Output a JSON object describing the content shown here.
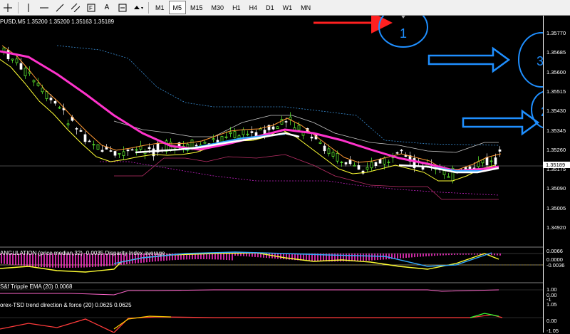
{
  "toolbar": {
    "tools": [
      "crosshair-icon",
      "vertical-line-icon",
      "horizontal-line-icon",
      "trendline-icon",
      "channel-icon",
      "fibonacci-icon",
      "text-icon",
      "label-icon",
      "shapes-icon"
    ],
    "text_tool": "A",
    "fib_label": "F",
    "timeframes": [
      "M1",
      "M5",
      "M15",
      "M30",
      "H1",
      "H4",
      "D1",
      "W1",
      "MN"
    ],
    "active_timeframe": "M5"
  },
  "symbol_info": "PUSD,M5  1.35200 1.35200 1.35163 1.35189",
  "price_axis": {
    "labels": [
      "1.35770",
      "1.35685",
      "1.35600",
      "1.35515",
      "1.35430",
      "1.35345",
      "1.35260",
      "1.35175",
      "1.35090",
      "1.35005",
      "1.34920"
    ],
    "current_price": "1.35189"
  },
  "annotations": [
    {
      "label": "1",
      "color": "#1f8fff"
    },
    {
      "label": "2",
      "color": "#1f8fff"
    },
    {
      "label": "3",
      "color": "#1f8fff"
    }
  ],
  "indicators": [
    {
      "label": "ANGULATION (price median,32) -0.0035  Disparity  Index average  ...",
      "scale": [
        "0.0066",
        "0.0000",
        "-0.0036"
      ]
    },
    {
      "label": "S&f Tripple EMA (20) 0.0068",
      "scale": [
        "1.00",
        "0.00",
        "-1"
      ]
    },
    {
      "label": "orex-TSD trend direction & force (20) 0.0625 0.0625",
      "scale": [
        "1.05",
        "0.00",
        "-1.05"
      ]
    }
  ],
  "colors": {
    "background": "#000000",
    "bull_candle": "#66ff33",
    "ema_magenta": "#ff33cc",
    "ema_white": "#ffffff",
    "ema_blue": "#33aaff",
    "ema_yellow": "#ffff33",
    "ema_orange": "#ff9933",
    "arrow_red": "#ff2020",
    "arrow_blue": "#1f8fff"
  }
}
